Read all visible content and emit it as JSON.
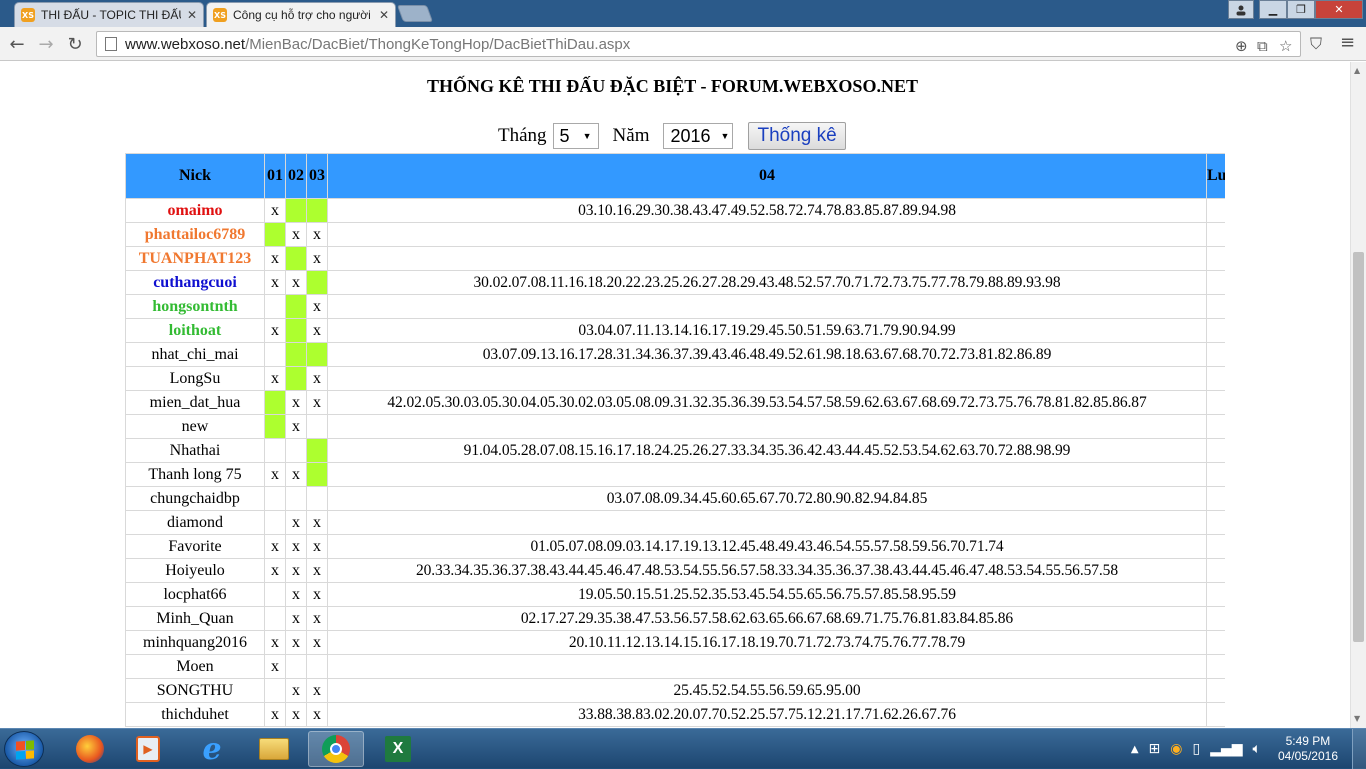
{
  "browser": {
    "tabs": [
      {
        "label": "THI ĐẤU - TOPIC THI ĐẤU",
        "favicon": "XS",
        "active": false
      },
      {
        "label": "Công cụ hỗ trợ cho người",
        "favicon": "XS",
        "active": true
      }
    ],
    "url_domain": "www.webxoso.net",
    "url_path": "/MienBac/DacBiet/ThongKeTongHop/DacBietThiDau.aspx"
  },
  "page": {
    "title": "THỐNG KÊ THI ĐẤU ĐẶC BIỆT - FORUM.WEBXOSO.NET",
    "month_label": "Tháng",
    "month_value": "5",
    "year_label": "Năm",
    "year_value": "2016",
    "submit_label": "Thống kê"
  },
  "table": {
    "headers": {
      "nick": "Nick",
      "c01": "01",
      "c02": "02",
      "c03": "03",
      "c04": "04",
      "last": "Lư"
    },
    "rows": [
      {
        "nick": "omaimo",
        "style": "red",
        "c01": "x",
        "c02": "",
        "c03": "",
        "g": [
          0,
          1,
          1
        ],
        "c04": "03.10.16.29.30.38.43.47.49.52.58.72.74.78.83.85.87.89.94.98"
      },
      {
        "nick": "phattailoc6789",
        "style": "orange",
        "c01": "",
        "c02": "x",
        "c03": "x",
        "g": [
          1,
          0,
          0
        ],
        "c04": ""
      },
      {
        "nick": "TUANPHAT123",
        "style": "orange",
        "c01": "x",
        "c02": "",
        "c03": "x",
        "g": [
          0,
          1,
          0
        ],
        "c04": ""
      },
      {
        "nick": "cuthangcuoi",
        "style": "blue",
        "c01": "x",
        "c02": "x",
        "c03": "",
        "g": [
          0,
          0,
          1
        ],
        "c04": "30.02.07.08.11.16.18.20.22.23.25.26.27.28.29.43.48.52.57.70.71.72.73.75.77.78.79.88.89.93.98"
      },
      {
        "nick": "hongsontnth",
        "style": "lgreen",
        "c01": "",
        "c02": "",
        "c03": "x",
        "g": [
          0,
          1,
          0
        ],
        "c04": ""
      },
      {
        "nick": "loithoat",
        "style": "lgreen",
        "c01": "x",
        "c02": "",
        "c03": "x",
        "g": [
          0,
          1,
          0
        ],
        "c04": "03.04.07.11.13.14.16.17.19.29.45.50.51.59.63.71.79.90.94.99"
      },
      {
        "nick": "nhat_chi_mai",
        "style": "",
        "c01": "",
        "c02": "",
        "c03": "",
        "g": [
          0,
          1,
          1
        ],
        "c04": "03.07.09.13.16.17.28.31.34.36.37.39.43.46.48.49.52.61.98.18.63.67.68.70.72.73.81.82.86.89"
      },
      {
        "nick": "LongSu",
        "style": "",
        "c01": "x",
        "c02": "",
        "c03": "x",
        "g": [
          0,
          1,
          0
        ],
        "c04": ""
      },
      {
        "nick": "mien_dat_hua",
        "style": "",
        "c01": "",
        "c02": "x",
        "c03": "x",
        "g": [
          1,
          0,
          0
        ],
        "c04": "42.02.05.30.03.05.30.04.05.30.02.03.05.08.09.31.32.35.36.39.53.54.57.58.59.62.63.67.68.69.72.73.75.76.78.81.82.85.86.87"
      },
      {
        "nick": "new",
        "style": "",
        "c01": "",
        "c02": "x",
        "c03": "",
        "g": [
          1,
          0,
          0
        ],
        "c04": ""
      },
      {
        "nick": "Nhathai",
        "style": "",
        "c01": "",
        "c02": "",
        "c03": "",
        "g": [
          0,
          0,
          1
        ],
        "c04": "91.04.05.28.07.08.15.16.17.18.24.25.26.27.33.34.35.36.42.43.44.45.52.53.54.62.63.70.72.88.98.99"
      },
      {
        "nick": "Thanh long 75",
        "style": "",
        "c01": "x",
        "c02": "x",
        "c03": "",
        "g": [
          0,
          0,
          1
        ],
        "c04": ""
      },
      {
        "nick": "chungchaidbp",
        "style": "",
        "c01": "",
        "c02": "",
        "c03": "",
        "g": [
          0,
          0,
          0
        ],
        "c04": "03.07.08.09.34.45.60.65.67.70.72.80.90.82.94.84.85"
      },
      {
        "nick": "diamond",
        "style": "",
        "c01": "",
        "c02": "x",
        "c03": "x",
        "g": [
          0,
          0,
          0
        ],
        "c04": ""
      },
      {
        "nick": "Favorite",
        "style": "",
        "c01": "x",
        "c02": "x",
        "c03": "x",
        "g": [
          0,
          0,
          0
        ],
        "c04": "01.05.07.08.09.03.14.17.19.13.12.45.48.49.43.46.54.55.57.58.59.56.70.71.74"
      },
      {
        "nick": "Hoiyeulo",
        "style": "",
        "c01": "x",
        "c02": "x",
        "c03": "x",
        "g": [
          0,
          0,
          0
        ],
        "c04": "20.33.34.35.36.37.38.43.44.45.46.47.48.53.54.55.56.57.58.33.34.35.36.37.38.43.44.45.46.47.48.53.54.55.56.57.58"
      },
      {
        "nick": "locphat66",
        "style": "",
        "c01": "",
        "c02": "x",
        "c03": "x",
        "g": [
          0,
          0,
          0
        ],
        "c04": "19.05.50.15.51.25.52.35.53.45.54.55.65.56.75.57.85.58.95.59"
      },
      {
        "nick": "Minh_Quan",
        "style": "",
        "c01": "",
        "c02": "x",
        "c03": "x",
        "g": [
          0,
          0,
          0
        ],
        "c04": "02.17.27.29.35.38.47.53.56.57.58.62.63.65.66.67.68.69.71.75.76.81.83.84.85.86"
      },
      {
        "nick": "minhquang2016",
        "style": "",
        "c01": "x",
        "c02": "x",
        "c03": "x",
        "g": [
          0,
          0,
          0
        ],
        "c04": "20.10.11.12.13.14.15.16.17.18.19.70.71.72.73.74.75.76.77.78.79"
      },
      {
        "nick": "Moen",
        "style": "",
        "c01": "x",
        "c02": "",
        "c03": "",
        "g": [
          0,
          0,
          0
        ],
        "c04": ""
      },
      {
        "nick": "SONGTHU",
        "style": "",
        "c01": "",
        "c02": "x",
        "c03": "x",
        "g": [
          0,
          0,
          0
        ],
        "c04": "25.45.52.54.55.56.59.65.95.00"
      },
      {
        "nick": "thichduhet",
        "style": "",
        "c01": "x",
        "c02": "x",
        "c03": "x",
        "g": [
          0,
          0,
          0
        ],
        "c04": "33.88.38.83.02.20.07.70.52.25.57.75.12.21.17.71.62.26.67.76"
      }
    ]
  },
  "taskbar": {
    "time": "5:49 PM",
    "date": "04/05/2016"
  },
  "colors": {
    "header_bg": "#3399ff",
    "highlight_green": "#adff2f"
  }
}
